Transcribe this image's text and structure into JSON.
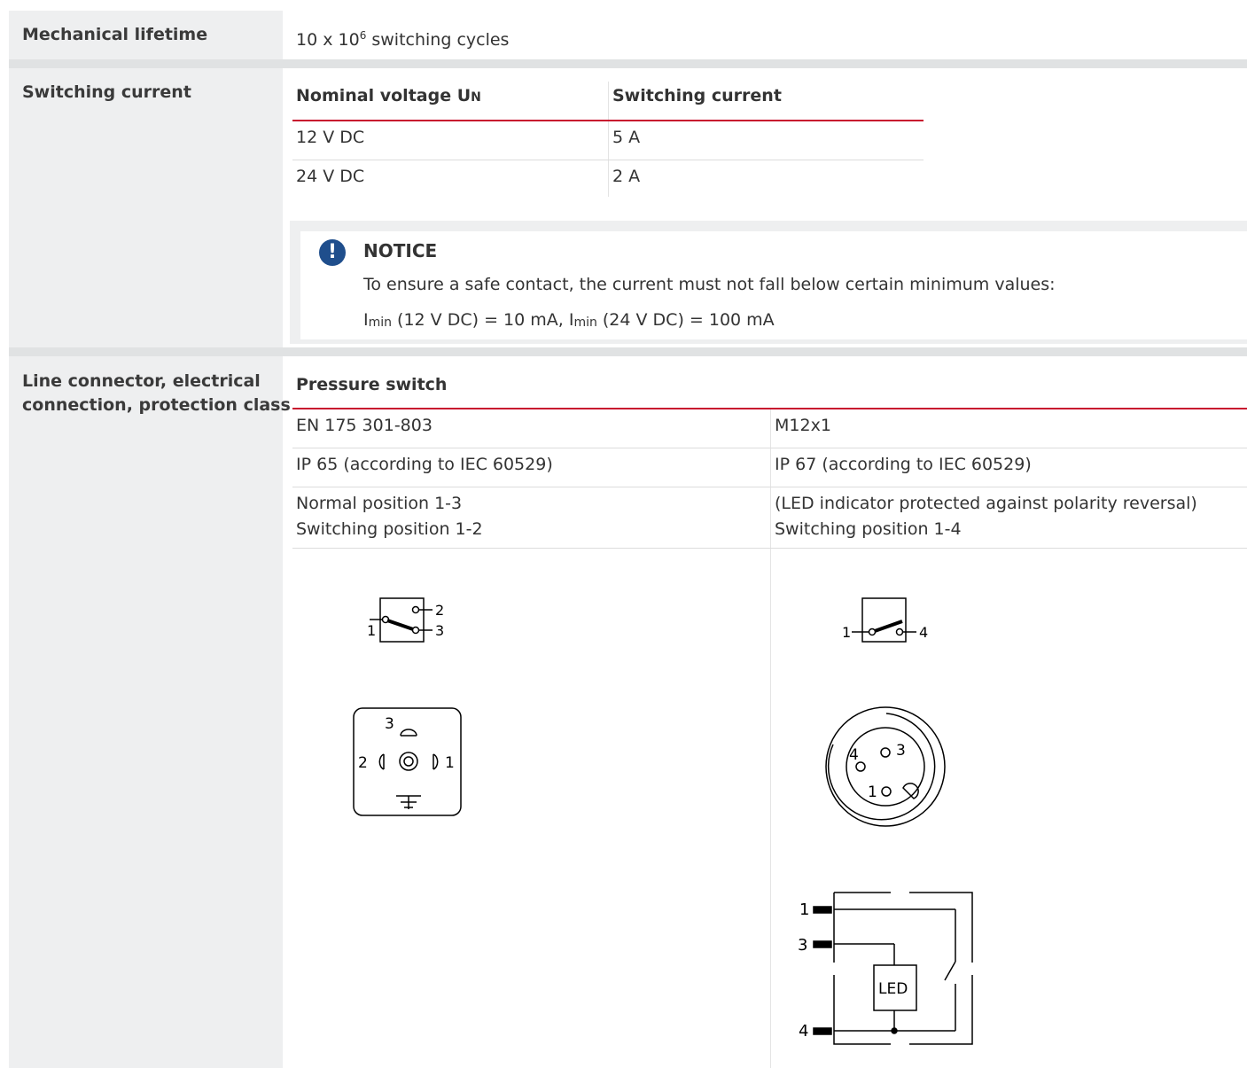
{
  "rows": {
    "mechanical_lifetime": {
      "label": "Mechanical lifetime",
      "value_prefix": "10 x 10",
      "value_sup": "6",
      "value_suffix": " switching cycles"
    },
    "switching_current": {
      "label": "Switching current",
      "table": {
        "headers": [
          "Nominal voltage U",
          "N",
          "Switching current"
        ],
        "rows": [
          [
            "12 V DC",
            "5 A"
          ],
          [
            "24 V DC",
            "2 A"
          ]
        ]
      },
      "notice": {
        "title": "NOTICE",
        "icon": "!",
        "line1": "To ensure a safe contact, the current must not fall below certain minimum values:",
        "line2_parts": [
          "I",
          "min",
          " (12 V DC) = 10 mA, I",
          "min",
          " (24 V DC) = 100 mA"
        ]
      }
    },
    "line_connector": {
      "label_line1": "Line connector, electrical",
      "label_line2": "connection, protection class",
      "table": {
        "header": "Pressure switch",
        "rows": [
          [
            "EN 175 301-803",
            "M12x1"
          ],
          [
            "IP 65 (according to IEC 60529)",
            "IP 67 (according to IEC 60529)"
          ]
        ],
        "row3_left": [
          "Normal position 1-3",
          "Switching position 1-2"
        ],
        "row3_right": [
          "(LED indicator protected against polarity reversal)",
          "Switching position 1-4"
        ]
      },
      "diagrams": {
        "left_switch_terminals": [
          "1",
          "2",
          "3"
        ],
        "left_plug_pins": [
          "3",
          "2",
          "1"
        ],
        "right_switch_terminals": [
          "1",
          "4"
        ],
        "right_plug_pins": [
          "4",
          "3",
          "1"
        ],
        "led_circuit_terminals": [
          "1",
          "3",
          "4"
        ],
        "led_label": "LED"
      }
    }
  },
  "colors": {
    "accent_red": "#c8102e",
    "notice_blue": "#1f4e8c",
    "label_bg": "#eeeff0"
  }
}
